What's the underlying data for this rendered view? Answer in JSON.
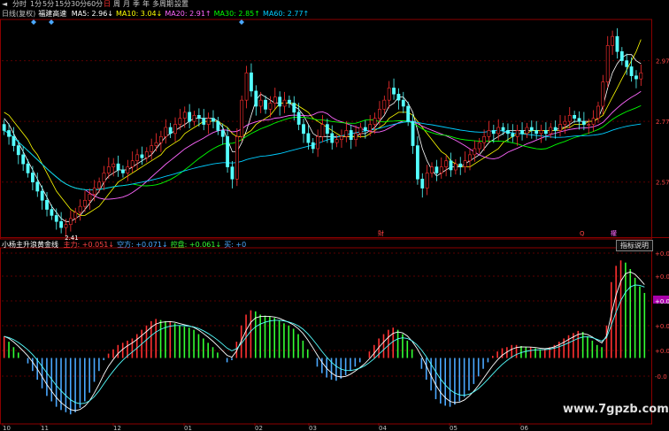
{
  "toolbar": {
    "items": [
      {
        "label": "◄",
        "active": false
      },
      {
        "label": "分时",
        "active": false
      },
      {
        "label": "1分",
        "active": false
      },
      {
        "label": "5分",
        "active": false
      },
      {
        "label": "15分",
        "active": false
      },
      {
        "label": "30分",
        "active": false
      },
      {
        "label": "60分",
        "active": false
      },
      {
        "label": "日",
        "active": true
      },
      {
        "label": "周",
        "active": false
      },
      {
        "label": "月",
        "active": false
      },
      {
        "label": "季",
        "active": false
      },
      {
        "label": "年",
        "active": false
      },
      {
        "label": "多周期",
        "active": false
      },
      {
        "label": "設置",
        "active": false
      }
    ]
  },
  "price_panel": {
    "header": "日线(复权)",
    "stock_name": "福建高速",
    "ma": [
      {
        "label": "MA5: 2.96",
        "arrow": "↓",
        "color": "#ffffff"
      },
      {
        "label": "MA10: 3.04",
        "arrow": "↓",
        "color": "#ffff00"
      },
      {
        "label": "MA20: 2.91",
        "arrow": "↑",
        "color": "#ff66ff"
      },
      {
        "label": "MA30: 2.85",
        "arrow": "↑",
        "color": "#00ff00"
      },
      {
        "label": "MA60: 2.77",
        "arrow": "↑",
        "color": "#00ccff"
      }
    ],
    "low_label": "2.41",
    "bottom_markers": [
      "財",
      "Q",
      "權"
    ]
  },
  "indicator_panel": {
    "name": "小杨主升浪黄金线",
    "items": [
      {
        "label": "主力: +0.051",
        "arrow": "↓",
        "color": "#ff4444"
      },
      {
        "label": "空方: +0.071",
        "arrow": "↓",
        "color": "#4aa8ff"
      },
      {
        "label": "控盘: +0.061",
        "arrow": "↓",
        "color": "#33ff33"
      },
      {
        "label": "买: +0",
        "arrow": "",
        "color": "#4aa8ff"
      }
    ],
    "help_button": "指标说明"
  },
  "watermark": "www.7gpzb.com",
  "chart_data": [
    {
      "type": "candlestick",
      "title": "日线(复权) 福建高速",
      "y_ticks": [
        "2.97",
        "2.77",
        "2.57"
      ],
      "ylim": [
        2.4,
        3.1
      ],
      "ma_lines": [
        "MA5",
        "MA10",
        "MA20",
        "MA30",
        "MA60"
      ],
      "ma_colors": [
        "#ffffff",
        "#ffff00",
        "#ff66ff",
        "#00ff00",
        "#00ccff"
      ],
      "closes": [
        2.74,
        2.72,
        2.69,
        2.66,
        2.63,
        2.6,
        2.57,
        2.54,
        2.51,
        2.48,
        2.46,
        2.44,
        2.42,
        2.43,
        2.45,
        2.47,
        2.49,
        2.51,
        2.53,
        2.55,
        2.57,
        2.6,
        2.62,
        2.63,
        2.61,
        2.6,
        2.62,
        2.64,
        2.66,
        2.65,
        2.67,
        2.69,
        2.7,
        2.72,
        2.75,
        2.73,
        2.76,
        2.78,
        2.8,
        2.77,
        2.79,
        2.78,
        2.76,
        2.78,
        2.77,
        2.74,
        2.72,
        2.62,
        2.58,
        2.72,
        2.84,
        2.93,
        2.87,
        2.82,
        2.84,
        2.81,
        2.83,
        2.85,
        2.82,
        2.84,
        2.83,
        2.8,
        2.76,
        2.73,
        2.7,
        2.68,
        2.72,
        2.76,
        2.73,
        2.7,
        2.71,
        2.72,
        2.74,
        2.71,
        2.73,
        2.75,
        2.74,
        2.76,
        2.78,
        2.81,
        2.84,
        2.88,
        2.86,
        2.84,
        2.82,
        2.77,
        2.69,
        2.58,
        2.55,
        2.6,
        2.62,
        2.6,
        2.62,
        2.64,
        2.61,
        2.63,
        2.62,
        2.64,
        2.66,
        2.68,
        2.7,
        2.72,
        2.74,
        2.73,
        2.75,
        2.74,
        2.73,
        2.72,
        2.74,
        2.73,
        2.75,
        2.74,
        2.73,
        2.74,
        2.73,
        2.75,
        2.74,
        2.76,
        2.77,
        2.79,
        2.78,
        2.77,
        2.76,
        2.76,
        2.78,
        2.82,
        2.9,
        3.02,
        3.05,
        3.0,
        2.97,
        2.95,
        2.92,
        2.91,
        2.93
      ],
      "ma_values": {
        "MA5": [
          2.78,
          2.76,
          2.73,
          2.7,
          2.67,
          2.64,
          2.61,
          2.58,
          2.55,
          2.52,
          2.49,
          2.47,
          2.45,
          2.44,
          2.44,
          2.45,
          2.46,
          2.48,
          2.5,
          2.52,
          2.54,
          2.57,
          2.59,
          2.6,
          2.61,
          2.61,
          2.61,
          2.62,
          2.63,
          2.64,
          2.65,
          2.66,
          2.68,
          2.7,
          2.72,
          2.73,
          2.74,
          2.75,
          2.76,
          2.77,
          2.78,
          2.78,
          2.78,
          2.78,
          2.78,
          2.77,
          2.75,
          2.71,
          2.67,
          2.67,
          2.7,
          2.74,
          2.79,
          2.84,
          2.86,
          2.85,
          2.84,
          2.83,
          2.83,
          2.83,
          2.83,
          2.82,
          2.81,
          2.79,
          2.76,
          2.73,
          2.72,
          2.72,
          2.72,
          2.72,
          2.72,
          2.72,
          2.72,
          2.72,
          2.72,
          2.73,
          2.73,
          2.74,
          2.75,
          2.77,
          2.79,
          2.82,
          2.83,
          2.85,
          2.85,
          2.83,
          2.8,
          2.74,
          2.68,
          2.64,
          2.61,
          2.59,
          2.6,
          2.61,
          2.62,
          2.62,
          2.62,
          2.63,
          2.64,
          2.65,
          2.66,
          2.68,
          2.7,
          2.71,
          2.72,
          2.73,
          2.74,
          2.74,
          2.74,
          2.74,
          2.74,
          2.74,
          2.74,
          2.74,
          2.74,
          2.74,
          2.74,
          2.75,
          2.75,
          2.76,
          2.77,
          2.77,
          2.77,
          2.77,
          2.77,
          2.78,
          2.82,
          2.88,
          2.93,
          2.96,
          2.98,
          2.99,
          2.99,
          2.97,
          2.96
        ],
        "MA10": [
          2.8,
          2.79,
          2.77,
          2.75,
          2.73,
          2.71,
          2.68,
          2.66,
          2.63,
          2.6,
          2.57,
          2.54,
          2.52,
          2.5,
          2.48,
          2.47,
          2.46,
          2.46,
          2.47,
          2.48,
          2.49,
          2.51,
          2.53,
          2.55,
          2.57,
          2.58,
          2.59,
          2.6,
          2.61,
          2.62,
          2.63,
          2.64,
          2.65,
          2.66,
          2.68,
          2.69,
          2.7,
          2.71,
          2.73,
          2.74,
          2.75,
          2.76,
          2.77,
          2.77,
          2.77,
          2.77,
          2.76,
          2.75,
          2.73,
          2.72,
          2.72,
          2.73,
          2.74,
          2.76,
          2.77,
          2.78,
          2.79,
          2.81,
          2.83,
          2.83,
          2.83,
          2.83,
          2.82,
          2.81,
          2.8,
          2.78,
          2.77,
          2.76,
          2.75,
          2.74,
          2.73,
          2.72,
          2.72,
          2.72,
          2.72,
          2.72,
          2.72,
          2.73,
          2.74,
          2.75,
          2.76,
          2.78,
          2.79,
          2.8,
          2.8,
          2.8,
          2.79,
          2.77,
          2.75,
          2.73,
          2.71,
          2.69,
          2.67,
          2.66,
          2.64,
          2.63,
          2.62,
          2.62,
          2.62,
          2.63,
          2.64,
          2.65,
          2.66,
          2.67,
          2.68,
          2.7,
          2.71,
          2.72,
          2.73,
          2.73,
          2.73,
          2.74,
          2.74,
          2.74,
          2.74,
          2.74,
          2.74,
          2.74,
          2.75,
          2.75,
          2.76,
          2.76,
          2.76,
          2.77,
          2.77,
          2.78,
          2.79,
          2.82,
          2.85,
          2.88,
          2.91,
          2.94,
          2.97,
          3.0,
          3.04
        ]
      }
    },
    {
      "type": "bar",
      "title": "小杨主升浪黄金线",
      "y_ticks": [
        "+0.0",
        "+0.0",
        "+0.0",
        "+0.0",
        "+0.0",
        "-0.0"
      ],
      "series": [
        {
          "name": "主力",
          "color": "#ff3030"
        },
        {
          "name": "空方",
          "color": "#4aa8ff"
        },
        {
          "name": "控盘",
          "color": "#33ff33"
        }
      ],
      "values": [
        0.02,
        0.015,
        0.01,
        0.005,
        0.0,
        -0.005,
        -0.012,
        -0.02,
        -0.028,
        -0.035,
        -0.04,
        -0.045,
        -0.048,
        -0.05,
        -0.052,
        -0.05,
        -0.046,
        -0.04,
        -0.032,
        -0.022,
        -0.012,
        -0.002,
        0.004,
        0.008,
        0.012,
        0.014,
        0.016,
        0.018,
        0.022,
        0.026,
        0.03,
        0.034,
        0.036,
        0.035,
        0.034,
        0.034,
        0.032,
        0.03,
        0.029,
        0.028,
        0.026,
        0.022,
        0.018,
        0.014,
        0.01,
        0.005,
        0.0,
        -0.004,
        -0.002,
        0.015,
        0.03,
        0.04,
        0.044,
        0.043,
        0.04,
        0.039,
        0.038,
        0.037,
        0.035,
        0.032,
        0.03,
        0.027,
        0.022,
        0.016,
        0.008,
        0.0,
        -0.008,
        -0.014,
        -0.018,
        -0.02,
        -0.021,
        -0.019,
        -0.016,
        -0.012,
        -0.008,
        -0.004,
        0.0,
        0.006,
        0.012,
        0.018,
        0.022,
        0.026,
        0.028,
        0.026,
        0.022,
        0.016,
        0.008,
        0.0,
        -0.01,
        -0.02,
        -0.03,
        -0.038,
        -0.042,
        -0.044,
        -0.045,
        -0.043,
        -0.04,
        -0.036,
        -0.03,
        -0.024,
        -0.017,
        -0.01,
        -0.004,
        0.002,
        0.006,
        0.009,
        0.01,
        0.012,
        0.012,
        0.011,
        0.01,
        0.01,
        0.009,
        0.008,
        0.008,
        0.01,
        0.012,
        0.015,
        0.018,
        0.021,
        0.023,
        0.025,
        0.024,
        0.02,
        0.016,
        0.012,
        0.01,
        0.03,
        0.07,
        0.085,
        0.09,
        0.088,
        0.082,
        0.074,
        0.066,
        0.06
      ],
      "ylim": [
        -0.06,
        0.1
      ]
    }
  ],
  "x_ticks": [
    "10",
    "11",
    "12",
    "01",
    "02",
    "03",
    "04",
    "05",
    "06"
  ]
}
